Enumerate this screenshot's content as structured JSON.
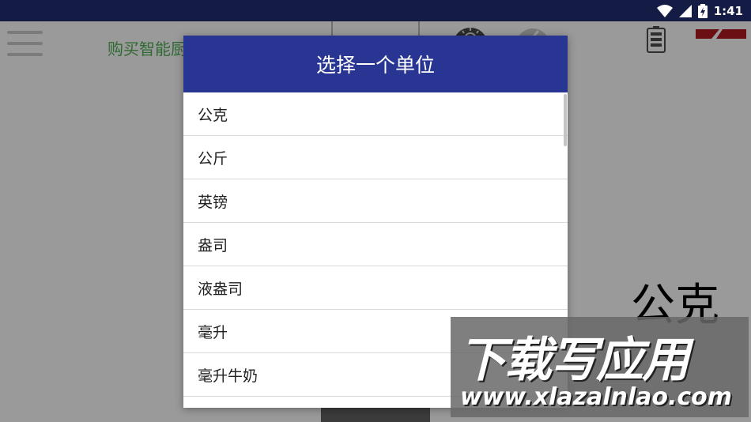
{
  "status_bar": {
    "time": "1:41",
    "icons": [
      "wifi-icon",
      "cell-signal-icon",
      "battery-charging-icon"
    ],
    "background": "#141b44"
  },
  "app": {
    "buy_link_text": "购买智能厨",
    "current_unit": "公克",
    "icons": [
      "menu-icon",
      "light-bulb-icon",
      "mute-icon",
      "battery-icon",
      "flag-icon"
    ],
    "accent_green": "#2f6a33"
  },
  "dialog": {
    "title": "选择一个单位",
    "header_color": "#283593",
    "items": [
      {
        "label": "公克"
      },
      {
        "label": "公斤"
      },
      {
        "label": "英镑"
      },
      {
        "label": "盎司"
      },
      {
        "label": "液盎司"
      },
      {
        "label": "毫升"
      },
      {
        "label": "毫升牛奶"
      }
    ]
  },
  "watermark": {
    "text": "下载写应用",
    "url": "www.xlazalnlao.com"
  }
}
